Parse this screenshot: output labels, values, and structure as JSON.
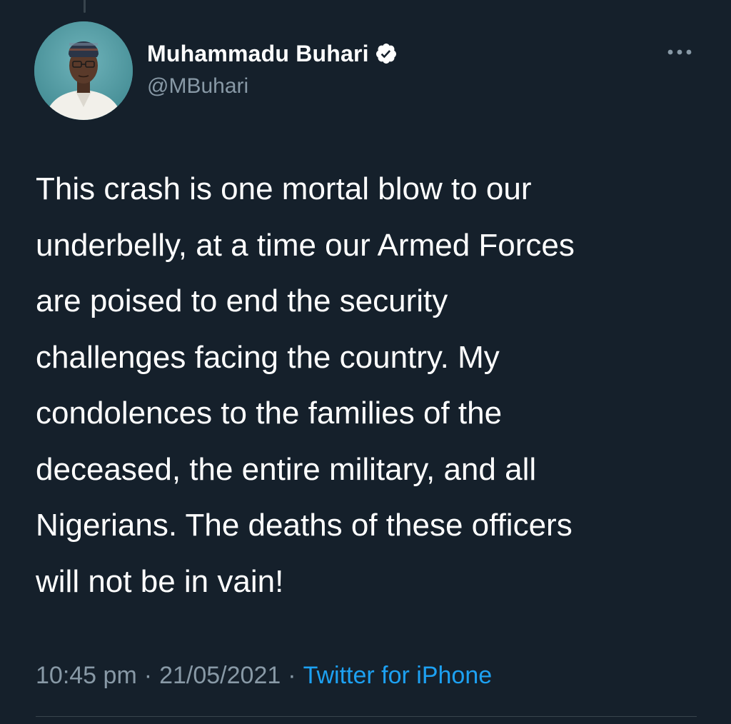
{
  "tweet": {
    "author": {
      "display_name": "Muhammadu Buhari",
      "handle": "@MBuhari",
      "verified": true,
      "avatar_icon": "profile-photo"
    },
    "more_icon": "more-horizontal-icon",
    "text": "This crash is one mortal blow to our\nunderbelly, at a time our Armed Forces\nare poised to end the security\nchallenges facing the country. My\ncondolences to the families of the\ndeceased, the entire military, and all\nNigerians. The deaths of these officers\nwill not be in vain!",
    "time": "10:45 pm",
    "separator": "·",
    "date": "21/05/2021",
    "source": "Twitter for iPhone"
  },
  "colors": {
    "background": "#15202b",
    "text_primary": "#ffffff",
    "text_secondary": "#8899a6",
    "accent": "#1da1f2",
    "divider": "#38444d"
  }
}
